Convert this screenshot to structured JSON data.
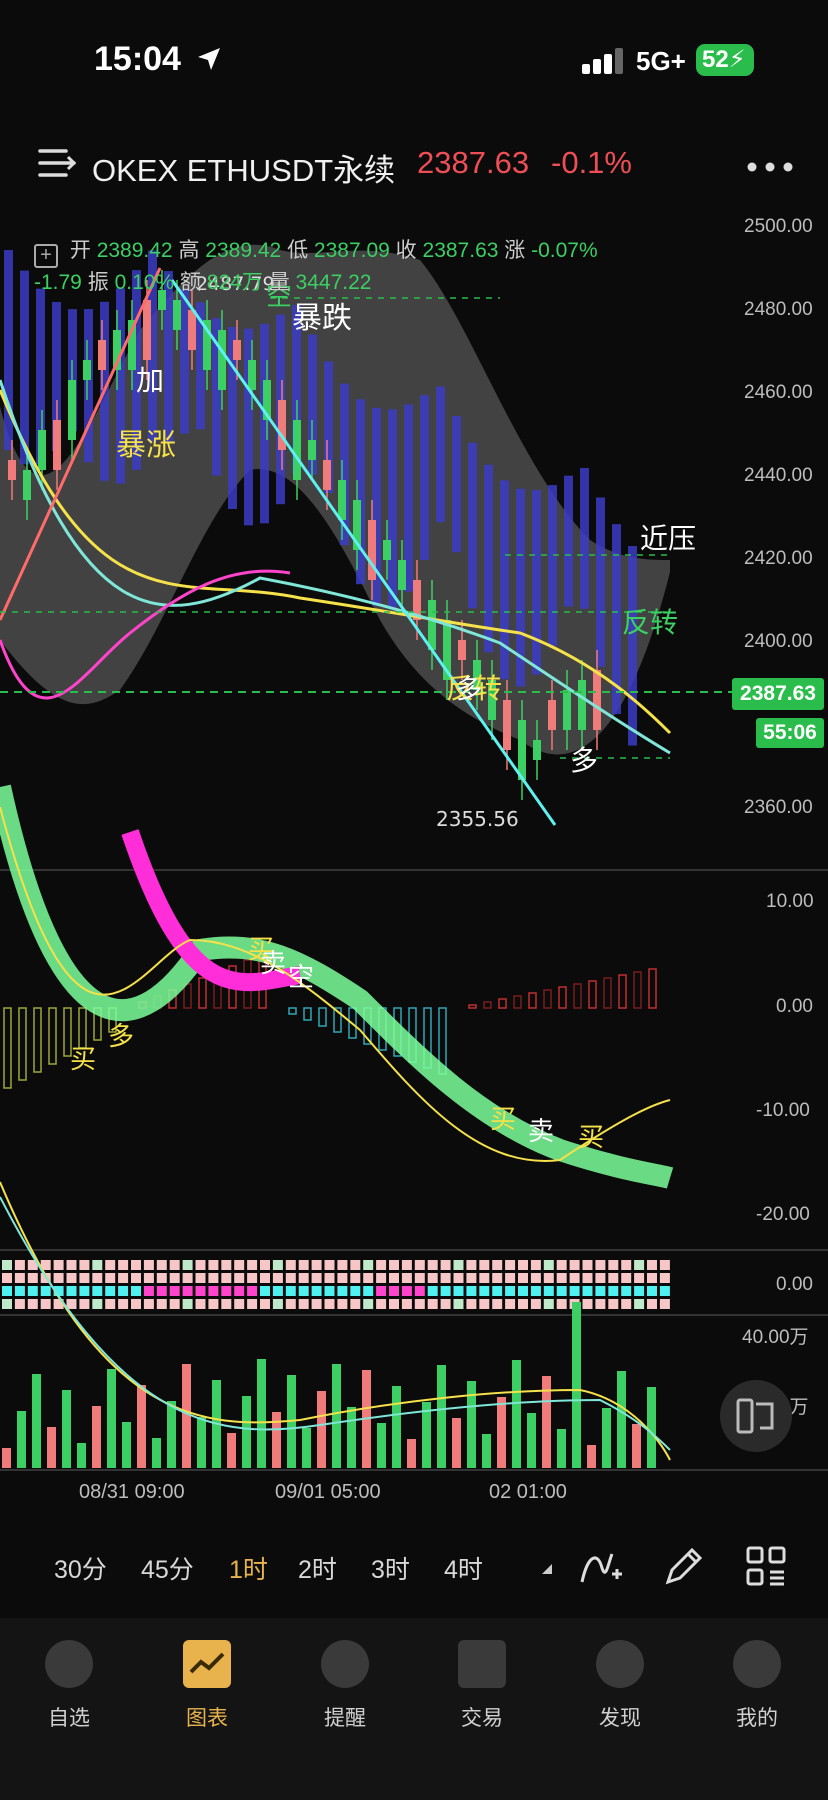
{
  "status": {
    "time": "15:04",
    "network": "5G+",
    "battery": "52"
  },
  "header": {
    "symbol": "OKEX ETHUSDT永续",
    "price": "2387.63",
    "change_pct": "-0.1%"
  },
  "ohlc": {
    "open_label": "开",
    "open": "2389.42",
    "high_label": "高",
    "high": "2389.42",
    "low_label": "低",
    "low": "2387.09",
    "close_label": "收",
    "close": "2387.63",
    "change_label": "涨",
    "change": "-0.07%",
    "change_abs": "-1.79",
    "amp_label": "振",
    "amp": "0.10%",
    "amount_label": "额",
    "amount": "824万",
    "volume_label": "量",
    "volume": "3447.22"
  },
  "price_axis": [
    "2500.00",
    "2480.00",
    "2460.00",
    "2440.00",
    "2420.00",
    "2400.00",
    "2380.00",
    "2360.00"
  ],
  "macd_axis": [
    "10.00",
    "0.00",
    "-10.00",
    "-20.00"
  ],
  "signal_axis": "0.00",
  "volume_axis": [
    "40.00万",
    "20.00万"
  ],
  "current_price_tag": "2387.63",
  "countdown_tag": "55:06",
  "high_marker": "2487.79",
  "low_marker": "2355.56",
  "annotations": {
    "jia": "加",
    "baozhang": "暴涨",
    "baodie": "暴跌",
    "kong_top": "空",
    "fanzhuan1": "反转",
    "fanzhuan2": "反转",
    "jinya": "近压",
    "duo1": "多",
    "duo2": "多",
    "macd_mai1": "买",
    "macd_duo": "多",
    "macd_mai2": "买",
    "macd_mai_sell": "卖",
    "macd_kong": "空",
    "macd_mai3": "买",
    "macd_sell2": "卖",
    "macd_mai4": "买"
  },
  "time_axis": [
    "08/31 09:00",
    "09/01 05:00",
    "02 01:00"
  ],
  "timeframes": [
    {
      "label": "30分",
      "active": false
    },
    {
      "label": "45分",
      "active": false
    },
    {
      "label": "1时",
      "active": true
    },
    {
      "label": "2时",
      "active": false
    },
    {
      "label": "3时",
      "active": false
    },
    {
      "label": "4时",
      "active": false
    }
  ],
  "nav": [
    {
      "label": "自选",
      "active": false
    },
    {
      "label": "图表",
      "active": true
    },
    {
      "label": "提醒",
      "active": false
    },
    {
      "label": "交易",
      "active": false
    },
    {
      "label": "发现",
      "active": false
    },
    {
      "label": "我的",
      "active": false
    }
  ],
  "colors": {
    "up": "#3ccf63",
    "down": "#ee4e56",
    "accent": "#e8b34d",
    "tag": "#2bbd4b"
  }
}
